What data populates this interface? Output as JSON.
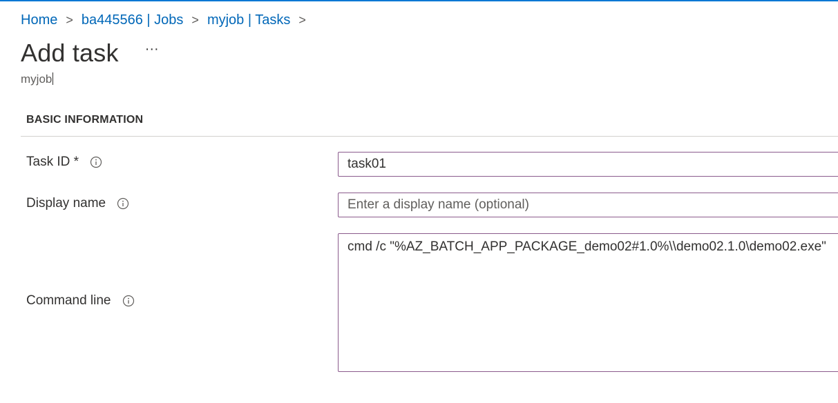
{
  "breadcrumb": {
    "items": [
      "Home",
      "ba445566 | Jobs",
      "myjob | Tasks"
    ],
    "separator": ">"
  },
  "page": {
    "title": "Add task",
    "more_label": "···",
    "subtitle": "myjob"
  },
  "section": {
    "header": "BASIC INFORMATION"
  },
  "fields": {
    "task_id": {
      "label": "Task ID *",
      "value": "task01"
    },
    "display_name": {
      "label": "Display name",
      "placeholder": "Enter a display name (optional)"
    },
    "command_line": {
      "label": "Command line",
      "value": "cmd /c \"%AZ_BATCH_APP_PACKAGE_demo02#1.0%\\\\demo02.1.0\\demo02.exe\""
    }
  },
  "colors": {
    "accent": "#0078d4",
    "link": "#0067b8",
    "input_border": "#8a5a8c"
  },
  "icons": {
    "info": "info-circle-icon",
    "breadcrumb_separator": "chevron-right-icon"
  }
}
